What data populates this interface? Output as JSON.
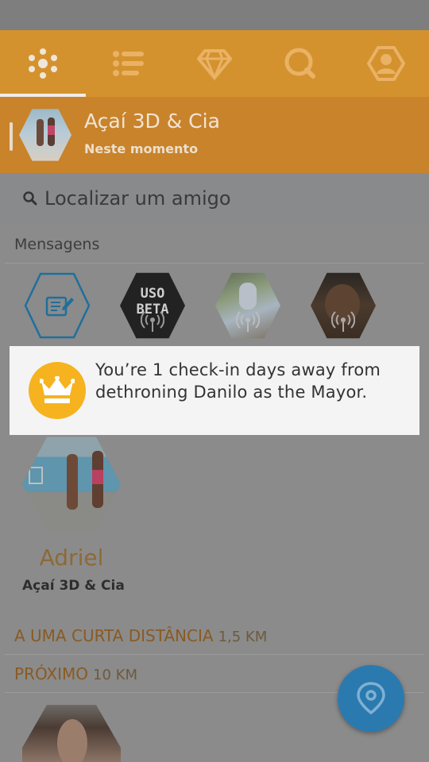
{
  "tabs": [
    {
      "name": "activity",
      "icon": "dots-cluster-icon",
      "active": true
    },
    {
      "name": "list",
      "icon": "list-icon",
      "active": false
    },
    {
      "name": "rewards",
      "icon": "diamond-icon",
      "active": false
    },
    {
      "name": "search",
      "icon": "search-icon",
      "active": false
    },
    {
      "name": "profile",
      "icon": "profile-icon",
      "active": false
    }
  ],
  "checkin": {
    "title": "Açaí 3D & Cia",
    "subtitle": "Neste momento"
  },
  "search": {
    "placeholder": "Localizar um amigo"
  },
  "messages": {
    "header": "Mensagens",
    "compose_icon": "edit-icon",
    "thumb_labels": [
      "USO BETA",
      "",
      ""
    ]
  },
  "overlay": {
    "text": "You’re 1 check-in days away from dethroning Danilo as the Mayor.",
    "icon": "crown-icon"
  },
  "friend": {
    "name": "Adriel",
    "venue": "Açaí 3D & Cia"
  },
  "distance_sections": [
    {
      "label": "A UMA CURTA DISTÂNCIA",
      "distance": "1,5 KM"
    },
    {
      "label": "PRÓXIMO",
      "distance": "10 KM"
    }
  ],
  "fab": {
    "icon": "location-pin-icon"
  },
  "colors": {
    "brand_orange": "#d4922e",
    "crown_yellow": "#f6b31f",
    "fab_blue": "#2a7ab0"
  }
}
